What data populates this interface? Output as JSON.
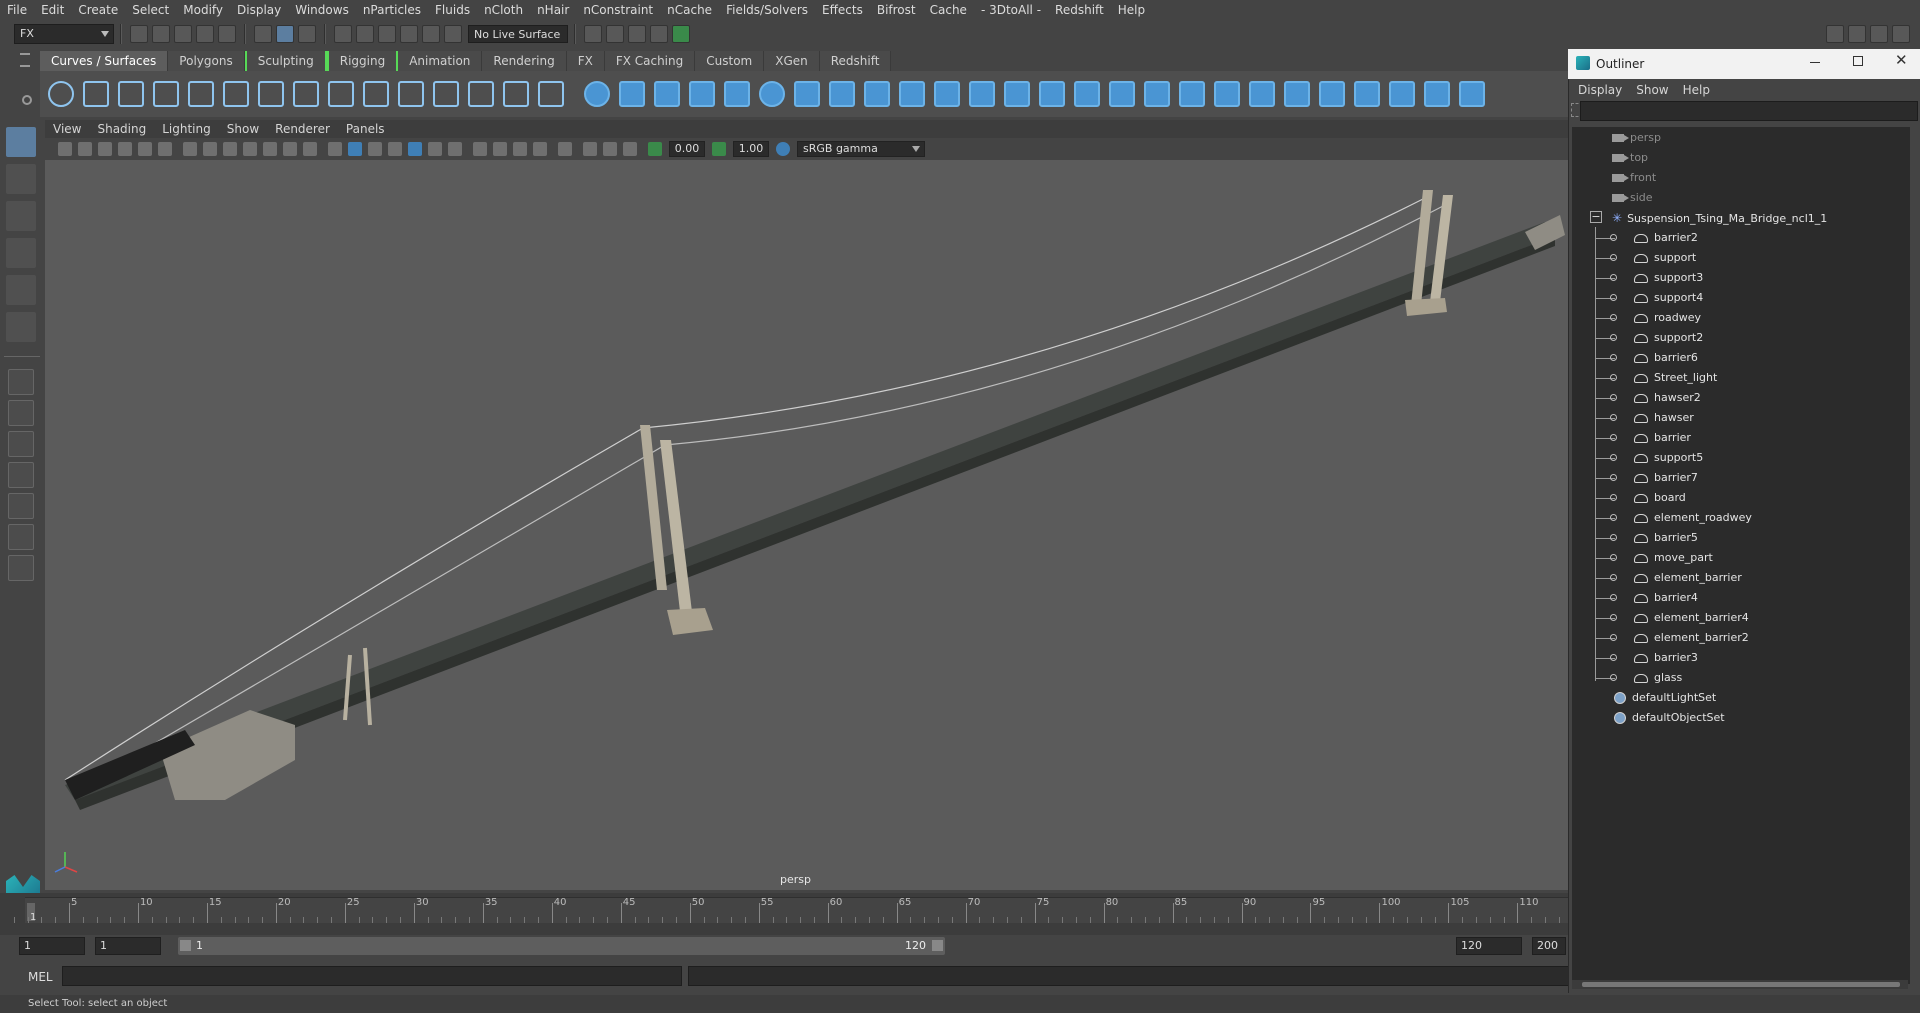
{
  "menubar": [
    "File",
    "Edit",
    "Create",
    "Select",
    "Modify",
    "Display",
    "Windows",
    "nParticles",
    "Fluids",
    "nCloth",
    "nHair",
    "nConstraint",
    "nCache",
    "Fields/Solvers",
    "Effects",
    "Bifrost",
    "Cache",
    "- 3DtoAll -",
    "Redshift",
    "Help"
  ],
  "statusline": {
    "mode": "FX",
    "live_surface": "No Live Surface"
  },
  "shelf_tabs": [
    "Curves / Surfaces",
    "Polygons",
    "Sculpting",
    "Rigging",
    "Animation",
    "Rendering",
    "FX",
    "FX Caching",
    "Custom",
    "XGen",
    "Redshift"
  ],
  "shelf_active_tab": "Curves / Surfaces",
  "panel_menu": [
    "View",
    "Shading",
    "Lighting",
    "Show",
    "Renderer",
    "Panels"
  ],
  "panel_toolbar": {
    "exposure": "0.00",
    "gamma_value": "1.00",
    "color_space": "sRGB gamma"
  },
  "viewport": {
    "camera_label": "persp"
  },
  "timeline": {
    "current_frame_marker": "1",
    "ticks": [
      "5",
      "10",
      "15",
      "20",
      "25",
      "30",
      "35",
      "40",
      "45",
      "50",
      "55",
      "60",
      "65",
      "70",
      "75",
      "80",
      "85",
      "90",
      "95",
      "100",
      "105",
      "110",
      "1"
    ]
  },
  "range": {
    "start": "1",
    "playback_start": "1",
    "slider_start": "1",
    "slider_end": "120",
    "playback_end": "120",
    "end": "200"
  },
  "cmdline": {
    "label": "MEL"
  },
  "helpline": {
    "text": "Select Tool: select an object"
  },
  "outliner": {
    "title": "Outliner",
    "menu": [
      "Display",
      "Show",
      "Help"
    ],
    "cameras": [
      "persp",
      "top",
      "front",
      "side"
    ],
    "group": "Suspension_Tsing_Ma_Bridge_ncl1_1",
    "children": [
      "barrier2",
      "support",
      "support3",
      "support4",
      "roadwey",
      "support2",
      "barrier6",
      "Street_light",
      "hawser2",
      "hawser",
      "barrier",
      "support5",
      "barrier7",
      "board",
      "element_roadwey",
      "barrier5",
      "move_part",
      "element_barrier",
      "barrier4",
      "element_barrier4",
      "element_barrier2",
      "barrier3",
      "glass"
    ],
    "sets": [
      "defaultLightSet",
      "defaultObjectSet"
    ]
  },
  "colors": {
    "accent": "#57d957",
    "selection": "#5c7ea0",
    "shelf_icon": "#4a95d3"
  }
}
